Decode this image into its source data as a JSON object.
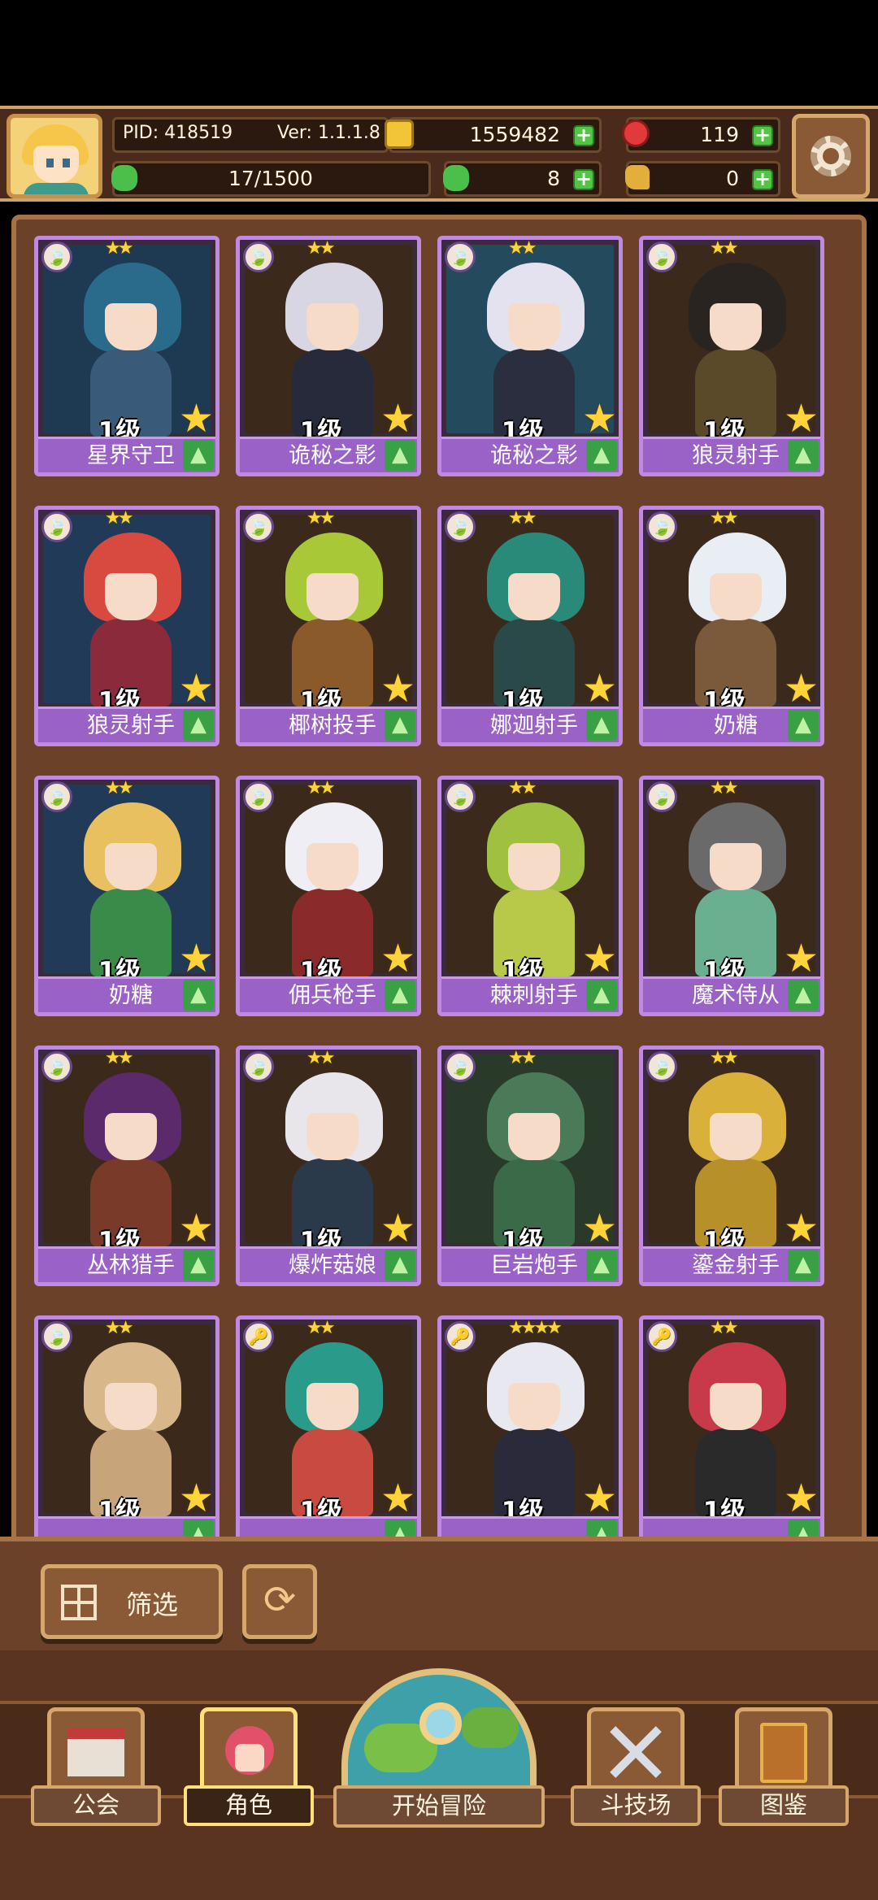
{
  "hud": {
    "pid": "PID: 418519",
    "version": "Ver: 1.1.1.8",
    "gold": "1559482",
    "gems": "119",
    "energy": "17/1500",
    "clover": "8",
    "boots": "0",
    "plus": "+"
  },
  "cards": [
    {
      "name": "星界守卫",
      "level": "1级",
      "stars": "★★",
      "hair": "#2a6a8a",
      "body": "#3a5a7a",
      "bg": "#1e3a52",
      "cls": "🍃"
    },
    {
      "name": "诡秘之影",
      "level": "1级",
      "stars": "★★",
      "hair": "#d8d6e2",
      "body": "#262a3a",
      "bg": "#3b2a1c",
      "cls": "🍃"
    },
    {
      "name": "诡秘之影",
      "level": "1级",
      "stars": "★★",
      "hair": "#e4e2ee",
      "body": "#2a2e3e",
      "bg": "#244a5e",
      "cls": "🍃"
    },
    {
      "name": "狼灵射手",
      "level": "1级",
      "stars": "★★",
      "hair": "#2a2420",
      "body": "#5a4a2a",
      "bg": "#3b2a1c",
      "cls": "🍃"
    },
    {
      "name": "狼灵射手",
      "level": "1级",
      "stars": "★★",
      "hair": "#d84a40",
      "body": "#8a2a3a",
      "bg": "#203a58",
      "cls": "🍃"
    },
    {
      "name": "椰树投手",
      "level": "1级",
      "stars": "★★",
      "hair": "#a8c838",
      "body": "#8a5a2a",
      "bg": "#3b2a1c",
      "cls": "🍃"
    },
    {
      "name": "娜迦射手",
      "level": "1级",
      "stars": "★★",
      "hair": "#2a8a7a",
      "body": "#2a4a4a",
      "bg": "#3b2a1c",
      "cls": "🍃"
    },
    {
      "name": "奶糖",
      "level": "1级",
      "stars": "★★",
      "hair": "#e8eef4",
      "body": "#7a5a3a",
      "bg": "#3b2a1c",
      "cls": "🍃"
    },
    {
      "name": "奶糖",
      "level": "1级",
      "stars": "★★",
      "hair": "#e8c060",
      "body": "#3a8a4a",
      "bg": "#203a58",
      "cls": "🍃"
    },
    {
      "name": "佣兵枪手",
      "level": "1级",
      "stars": "★★",
      "hair": "#eeeef4",
      "body": "#8a2a2a",
      "bg": "#3b2a1c",
      "cls": "🍃"
    },
    {
      "name": "棘刺射手",
      "level": "1级",
      "stars": "★★",
      "hair": "#a0c040",
      "body": "#b8c848",
      "bg": "#3b2a1c",
      "cls": "🍃"
    },
    {
      "name": "魔术侍从",
      "level": "1级",
      "stars": "★★",
      "hair": "#6a6a6a",
      "body": "#6ab090",
      "bg": "#3b2a1c",
      "cls": "🍃"
    },
    {
      "name": "丛林猎手",
      "level": "1级",
      "stars": "★★",
      "hair": "#5a2a6a",
      "body": "#7a3a2a",
      "bg": "#3b2a1c",
      "cls": "🍃"
    },
    {
      "name": "爆炸菇娘",
      "level": "1级",
      "stars": "★★",
      "hair": "#e8e6ea",
      "body": "#2a3a4a",
      "bg": "#3b2a1c",
      "cls": "🍃"
    },
    {
      "name": "巨岩炮手",
      "level": "1级",
      "stars": "★★",
      "hair": "#4a7a58",
      "body": "#3a6a48",
      "bg": "#2a3a2a",
      "cls": "🍃"
    },
    {
      "name": "鎏金射手",
      "level": "1级",
      "stars": "★★",
      "hair": "#d8b03a",
      "body": "#b8902a",
      "bg": "#3b2a1c",
      "cls": "🍃"
    },
    {
      "name": "",
      "level": "1级",
      "stars": "★★",
      "hair": "#d8b88a",
      "body": "#c8a47a",
      "bg": "#3b2a1c",
      "cls": "🍃"
    },
    {
      "name": "",
      "level": "1级",
      "stars": "★★",
      "hair": "#2a9a8a",
      "body": "#c84a40",
      "bg": "#3b2a1c",
      "cls": "🔑"
    },
    {
      "name": "",
      "level": "1级",
      "stars": "★★★★",
      "hair": "#e8e8f0",
      "body": "#2a2a3a",
      "bg": "#3b2a1c",
      "cls": "🔑"
    },
    {
      "name": "",
      "level": "1级",
      "stars": "★★",
      "hair": "#c83a4a",
      "body": "#2a2a2a",
      "bg": "#3b2a1c",
      "cls": "🔑"
    }
  ],
  "toolbar": {
    "filter_label": "筛选",
    "refresh_icon": "⟳"
  },
  "nav": {
    "guild": "公会",
    "heroes": "角色",
    "adventure": "开始冒险",
    "arena": "斗技场",
    "codex": "图鉴"
  },
  "colors": {
    "card_border": "#c08ae0",
    "name_bar": "#9a62c6",
    "star": "#ffd43a",
    "plus": "#55c248"
  }
}
